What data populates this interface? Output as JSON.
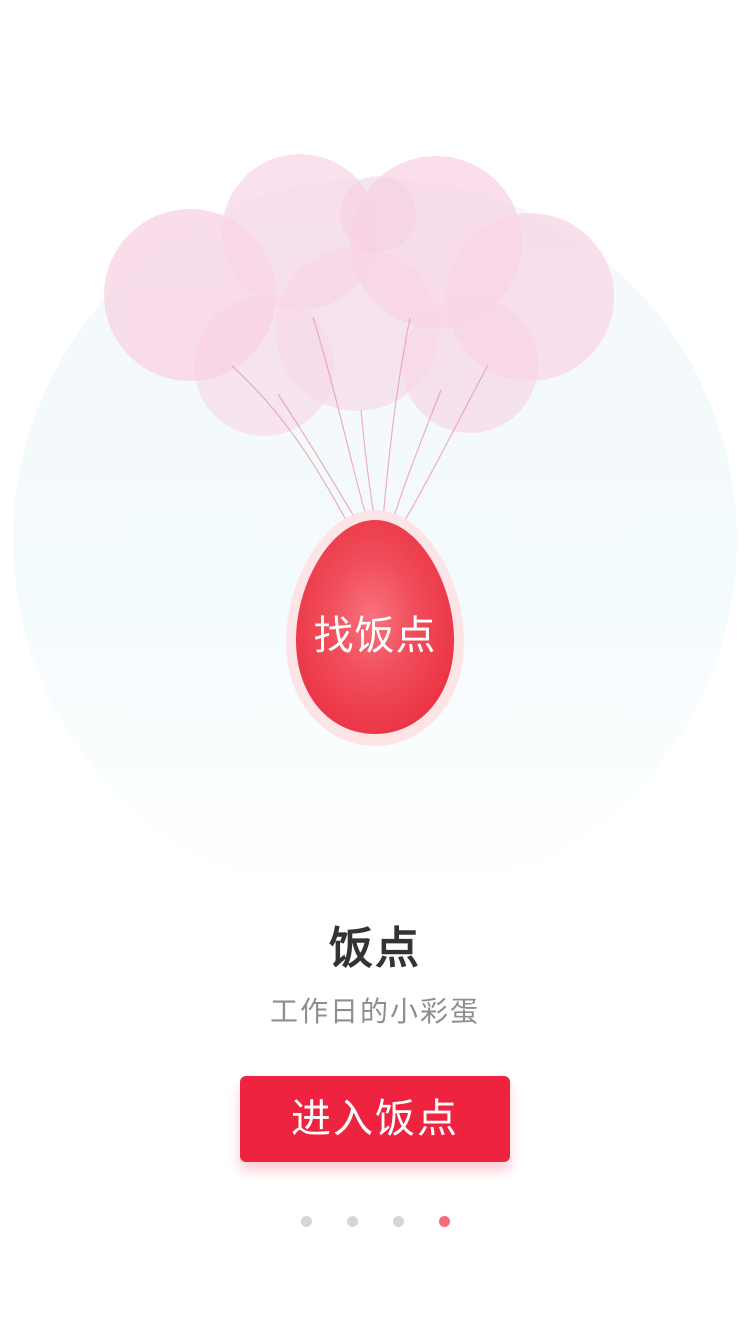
{
  "hero": {
    "egg_label": "找饭点"
  },
  "onboarding": {
    "title": "饭点",
    "subtitle": "工作日的小彩蛋",
    "cta_label": "进入饭点"
  },
  "pagination": {
    "total": 4,
    "active_index": 3
  },
  "colors": {
    "accent": "#ee2340",
    "active_dot": "#f46b7c",
    "inactive_dot": "#d6d6d6",
    "title": "#333333",
    "subtitle": "#8e8e8e",
    "balloon": "#f8cfe0"
  }
}
